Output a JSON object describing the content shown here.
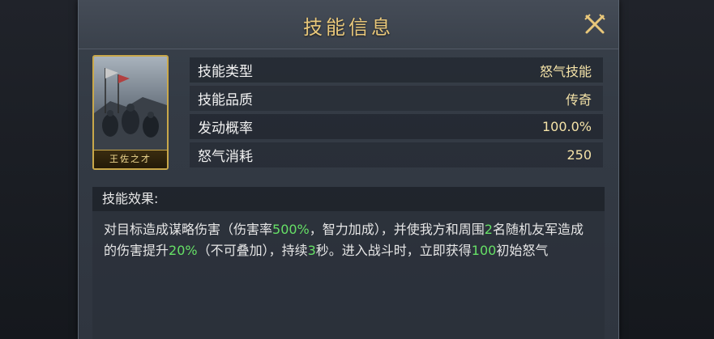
{
  "dialog": {
    "title": "技能信息"
  },
  "card": {
    "name": "王佐之才"
  },
  "rows": [
    {
      "label": "技能类型",
      "value": "怒气技能"
    },
    {
      "label": "技能品质",
      "value": "传奇"
    },
    {
      "label": "发动概率",
      "value": "100.0%"
    },
    {
      "label": "怒气消耗",
      "value": "250"
    }
  ],
  "effect": {
    "header": "技能效果:",
    "parts": [
      "对目标造成谋略伤害（伤害率",
      "500%",
      "，智力加成），并使我方和周围",
      "2",
      "名随机友军造成的伤害提升",
      "20%",
      "（不可叠加），持续",
      "3",
      "秒。进入战斗时，立即获得",
      "100",
      "初始怒气"
    ]
  },
  "colors": {
    "title": "#e8c77a",
    "value": "#f5e3a8",
    "highlight": "#66e066",
    "card_border": "#c9a84a"
  }
}
